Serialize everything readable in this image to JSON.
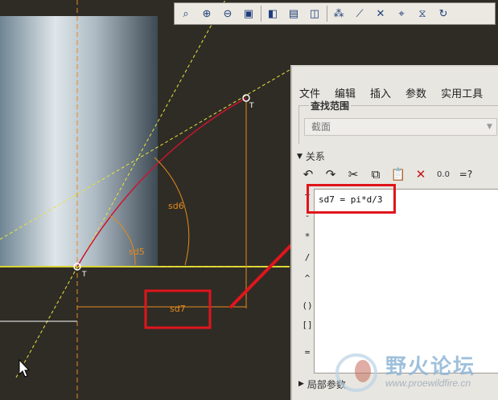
{
  "toolbar": {
    "icons": [
      "zoom-window-icon",
      "zoom-in-icon",
      "zoom-out-icon",
      "refit-icon",
      "orient-icon",
      "view-manager-icon",
      "saved-views-icon",
      "datum-planes-icon",
      "datum-axes-icon",
      "datum-points-icon",
      "coord-sys-icon",
      "annotation-icon",
      "repaint-icon"
    ]
  },
  "dialog": {
    "menu": [
      "文件",
      "编辑",
      "插入",
      "参数",
      "实用工具"
    ],
    "scope_label": "查找范围",
    "scope_value": "截面",
    "relations_label": "关系",
    "relation_text": "sd7 = pi*d/3",
    "side_symbols": [
      "+",
      "-",
      "*",
      "/",
      "^",
      "()",
      "[]",
      "="
    ],
    "local_params_label": "局部参数"
  },
  "sketch": {
    "dims": {
      "sd5": "sd5",
      "sd6": "sd6",
      "sd7": "sd7"
    },
    "point_markers": [
      "T",
      "T"
    ]
  },
  "watermark": {
    "title": "野火论坛",
    "url": "www.proewildfire.cn"
  },
  "colors": {
    "background": "#2f2c26",
    "dimension": "#e58a1c",
    "curve": "#cc1430",
    "construction": "#e8e33a",
    "highlight": "#e0151b"
  }
}
